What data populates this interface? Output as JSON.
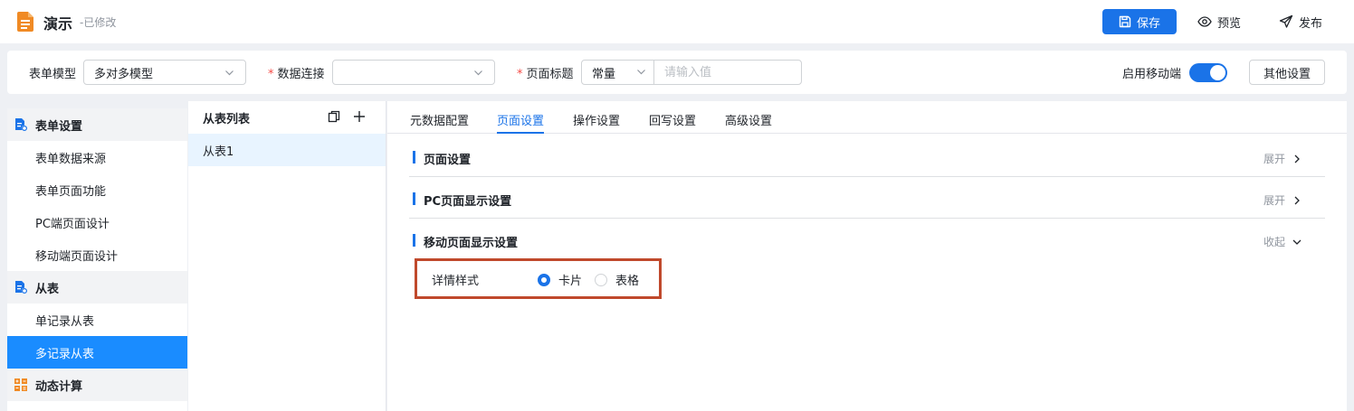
{
  "header": {
    "title": "演示",
    "status": "-已修改",
    "save_label": "保存",
    "preview_label": "预览",
    "publish_label": "发布"
  },
  "toolbar": {
    "form_model_label": "表单模型",
    "form_model_value": "多对多模型",
    "data_conn_label": "数据连接",
    "data_conn_value": "",
    "page_title_label": "页面标题",
    "page_title_type": "常量",
    "page_title_placeholder": "请输入值",
    "mobile_label": "启用移动端",
    "mobile_enabled": true,
    "other_settings_label": "其他设置"
  },
  "sidebar": {
    "groups": [
      {
        "title": "表单设置",
        "icon": "form-settings-icon",
        "items": [
          "表单数据来源",
          "表单页面功能",
          "PC端页面设计",
          "移动端页面设计"
        ]
      },
      {
        "title": "从表",
        "icon": "subtable-icon",
        "items": [
          "单记录从表",
          "多记录从表"
        ]
      },
      {
        "title": "动态计算",
        "icon": "calc-grid-icon",
        "items": []
      }
    ],
    "active_item": "多记录从表"
  },
  "sublist": {
    "title": "从表列表",
    "items": [
      "从表1"
    ]
  },
  "main": {
    "tabs": [
      "元数据配置",
      "页面设置",
      "操作设置",
      "回写设置",
      "高级设置"
    ],
    "active_tab": "页面设置",
    "sections": [
      {
        "title": "页面设置",
        "toggle": "展开"
      },
      {
        "title": "PC页面显示设置",
        "toggle": "展开"
      },
      {
        "title": "移动页面显示设置",
        "toggle": "收起"
      }
    ],
    "detail_style_label": "详情样式",
    "detail_style_options": [
      "卡片",
      "表格"
    ],
    "detail_style_selected": "卡片"
  },
  "colors": {
    "accent": "#1a73e8",
    "logo": "#f08a24",
    "active_item_bg": "#1a8cff",
    "highlight_box": "#c0492c"
  }
}
